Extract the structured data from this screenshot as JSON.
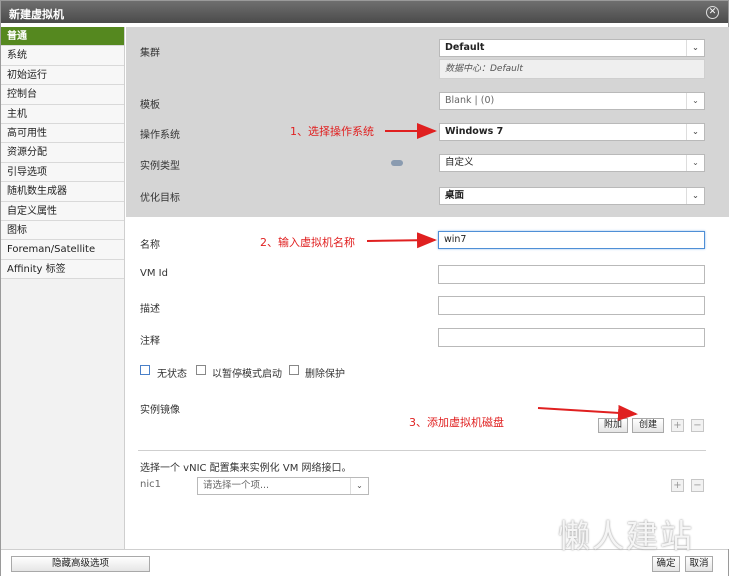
{
  "dialog": {
    "title": "新建虚拟机",
    "close_glyph": "✕"
  },
  "sidebar": {
    "items": [
      {
        "label": "普通",
        "active": true
      },
      {
        "label": "系统"
      },
      {
        "label": "初始运行"
      },
      {
        "label": "控制台"
      },
      {
        "label": "主机"
      },
      {
        "label": "高可用性"
      },
      {
        "label": "资源分配"
      },
      {
        "label": "引导选项"
      },
      {
        "label": "随机数生成器"
      },
      {
        "label": "自定义属性"
      },
      {
        "label": "图标"
      },
      {
        "label": "Foreman/Satellite"
      },
      {
        "label": "Affinity 标签"
      }
    ]
  },
  "general": {
    "cluster_label": "集群",
    "cluster_value": "Default",
    "cluster_note": "数据中心：Default",
    "template_label": "模板",
    "template_value": "Blank | (0)",
    "os_label": "操作系统",
    "os_value": "Windows 7",
    "instance_type_label": "实例类型",
    "instance_type_value": "自定义",
    "optimize_label": "优化目标",
    "optimize_value": "桌面",
    "name_label": "名称",
    "name_value": "win7",
    "vmid_label": "VM Id",
    "vmid_value": "",
    "desc_label": "描述",
    "desc_value": "",
    "comment_label": "注释",
    "comment_value": ""
  },
  "options": {
    "stateless": "无状态",
    "paused": "以暂停模式启动",
    "delete_protection": "删除保护"
  },
  "instance_images": {
    "label": "实例镜像",
    "attach_btn": "附加",
    "create_btn": "创建"
  },
  "network": {
    "heading": "选择一个 vNIC 配置集来实例化 VM 网络接口。",
    "nic_label": "nic1",
    "nic_placeholder": "请选择一个项..."
  },
  "annotations": {
    "a1": "1、选择操作系统",
    "a2": "2、输入虚拟机名称",
    "a3": "3、添加虚拟机磁盘",
    "color": "#e02020"
  },
  "footer": {
    "advanced_btn": "隐藏高级选项",
    "ok_btn": "确定",
    "cancel_btn": "取消"
  },
  "watermark": "懒人建站"
}
